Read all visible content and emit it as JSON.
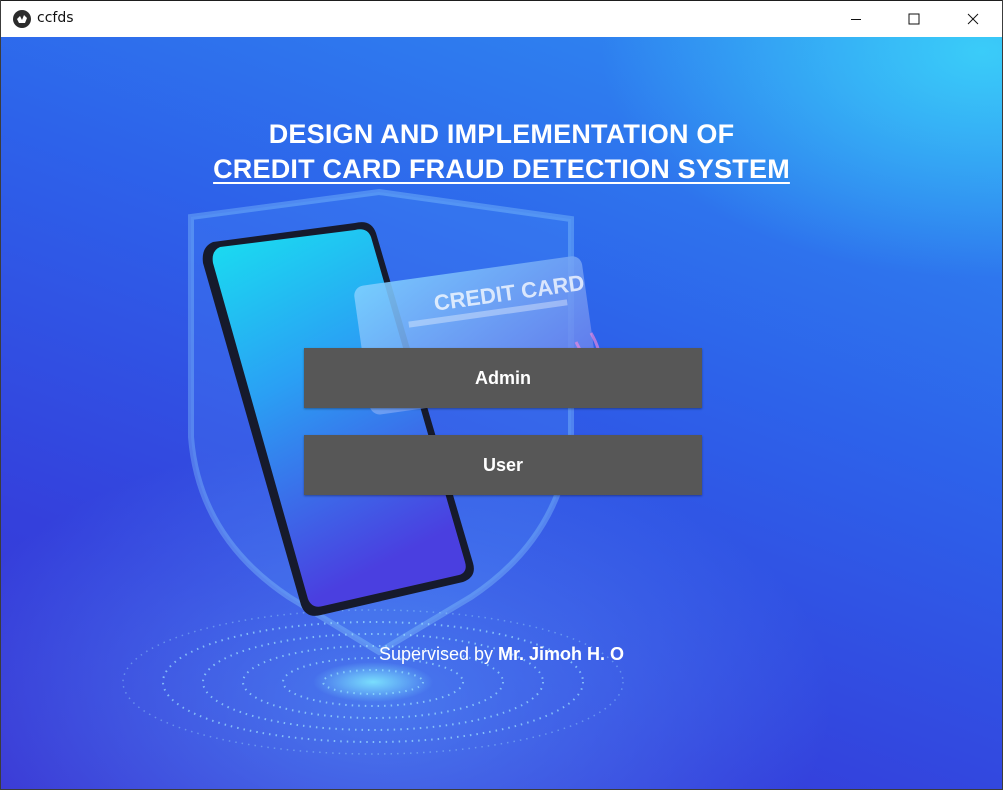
{
  "window": {
    "title": "ccfds",
    "app_icon": "kivy-logo-icon",
    "controls": {
      "minimize": "minimize-icon",
      "maximize": "maximize-icon",
      "close": "close-icon"
    }
  },
  "main": {
    "heading_line1": "DESIGN AND IMPLEMENTATION OF",
    "heading_line2": "CREDIT CARD FRAUD DETECTION SYSTEM",
    "illustration": {
      "card_text": "CREDIT CARD"
    },
    "buttons": {
      "admin": "Admin",
      "user": "User"
    },
    "footer": {
      "prefix": "Supervised by",
      "name": "Mr. Jimoh H. O"
    }
  },
  "colors": {
    "background_top": "#2f8ff2",
    "background_bottom": "#3a36d4",
    "button": "#575757",
    "text": "#ffffff"
  }
}
